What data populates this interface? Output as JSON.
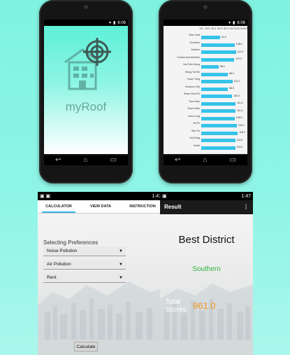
{
  "splash": {
    "app_title": "myRoof",
    "status_time": "6:06"
  },
  "data_view": {
    "status_time": "6:06",
    "axis_ticks": [
      "0.0",
      "20.0",
      "40.0",
      "60.0",
      "80.0",
      "100.0",
      "120.0",
      "140.0"
    ],
    "axis_max": 140,
    "chart_data": {
      "type": "bar",
      "categories": [
        "Wan Chai",
        "Southern",
        "Eastern",
        "Central and Western",
        "Yau Tsim Mong",
        "Wong Tai Sin",
        "Kwun Tong",
        "Kowloon City",
        "Sham Shui Po",
        "Tuen Mun",
        "Tsuen Wan",
        "Yuen Long",
        "Tai Po",
        "Sha Tin",
        "Sai Kung",
        "North"
      ],
      "values": [
        61.0,
        108.0,
        112.0,
        107.0,
        56.0,
        86.0,
        101.0,
        86.0,
        100.0,
        111.0,
        111.0,
        108.0,
        115.0,
        118.0,
        110.0,
        110.0
      ],
      "labels": [
        "61.0",
        "108.0",
        "112.0",
        "107.0",
        "56.0",
        "86.0",
        "101.0",
        "86.0",
        "100.0",
        "111.0",
        "111.0",
        "108.0",
        "115.0",
        "118.0",
        "110.0",
        "110.0"
      ],
      "xlim": [
        0,
        140
      ]
    }
  },
  "calculator": {
    "status_time": "1:47",
    "tabs": [
      {
        "label": "CALCULATOR"
      },
      {
        "label": "VIEW DATA"
      },
      {
        "label": "INSTRUCTION"
      }
    ],
    "heading": "Selecting Preferences",
    "dropdowns": [
      {
        "value": "Noise Pollution"
      },
      {
        "value": "Air Pollution"
      },
      {
        "value": "Rent"
      }
    ],
    "calculate_label": "Calculate"
  },
  "result": {
    "status_time": "1:47",
    "title": "Result",
    "menu_glyph": "⋮",
    "best_label": "Best District",
    "district": "Southern",
    "total_label_1": "Total",
    "total_label_2": "scores",
    "total_value": "961.0"
  },
  "colors": {
    "accent": "#33b5e5",
    "bar": "#35c3e8",
    "score": "#f39424",
    "district": "#33b33d"
  }
}
